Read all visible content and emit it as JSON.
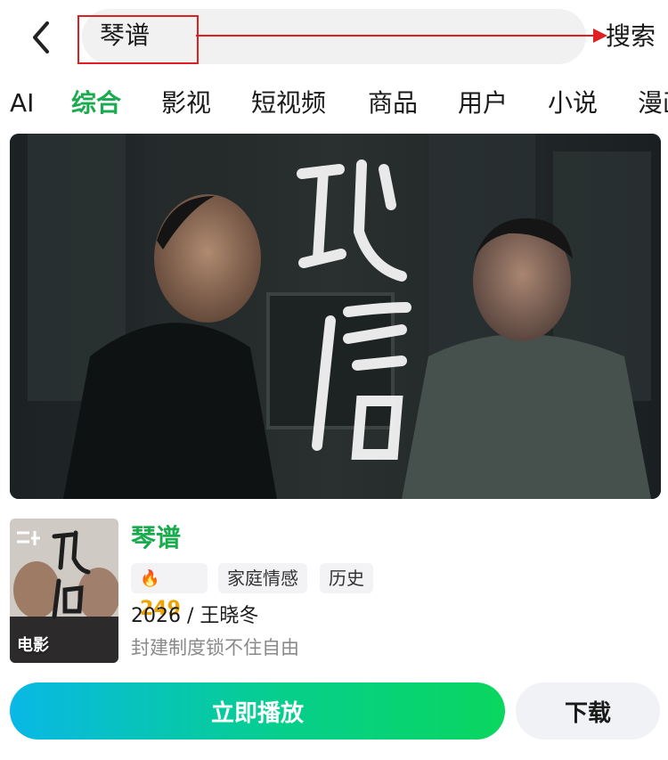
{
  "header": {
    "back_icon": "chevron-left-icon",
    "query": "琴谱",
    "search_label": "搜索"
  },
  "tabs": [
    {
      "label": "AI",
      "active": false
    },
    {
      "label": "综合",
      "active": true
    },
    {
      "label": "影视",
      "active": false
    },
    {
      "label": "短视频",
      "active": false
    },
    {
      "label": "商品",
      "active": false
    },
    {
      "label": "用户",
      "active": false
    },
    {
      "label": "小说",
      "active": false
    },
    {
      "label": "漫画",
      "active": false
    }
  ],
  "hero": {
    "poster_title": "琴谱"
  },
  "result": {
    "thumb_badge": "电影",
    "title": "琴谱",
    "heat": "249",
    "tags": [
      "家庭情感",
      "历史"
    ],
    "meta": "2026 / 王晓冬",
    "description": "封建制度锁不住自由"
  },
  "actions": {
    "play_label": "立即播放",
    "download_label": "下载"
  },
  "colors": {
    "accent": "#1aab4f",
    "heat": "#f0a300",
    "annotation": "#e02020"
  }
}
